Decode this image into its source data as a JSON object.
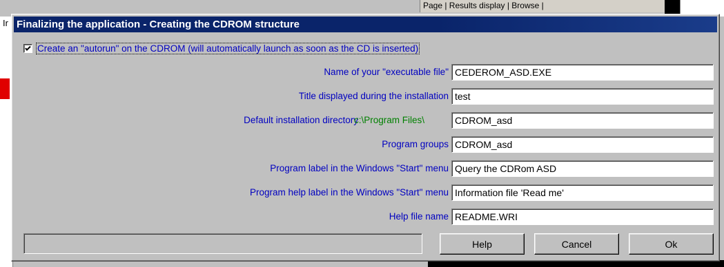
{
  "background": {
    "tabs_text": "Page | Results display | Browse |",
    "left_fragment": "Ir"
  },
  "dialog": {
    "title": "Finalizing the application - Creating the CDROM structure",
    "autorun": {
      "checked": true,
      "label": "Create an \"autorun\" on the CDROM (will automatically launch as soon as the CD is inserted)"
    },
    "fields": [
      {
        "label": "Name of your \"executable file\"",
        "value": "CEDEROM_ASD.EXE"
      },
      {
        "label": "Title displayed during the installation",
        "value": "test"
      },
      {
        "label": "Default installation directory",
        "prefix": "c:\\Program Files\\",
        "value": "CDROM_asd"
      },
      {
        "label": "Program groups",
        "value": "CDROM_asd"
      },
      {
        "label": "Program label in the Windows \"Start\" menu",
        "value": "Query the CDRom ASD"
      },
      {
        "label": "Program help label in the Windows \"Start\" menu",
        "value": "Information file 'Read me'"
      },
      {
        "label": "Help file name",
        "value": "README.WRI"
      }
    ],
    "buttons": {
      "help": "Help",
      "cancel": "Cancel",
      "ok": "Ok"
    }
  },
  "colors": {
    "title_bar": "#0a246a",
    "label_text": "#0000c0",
    "prefix_text": "#008000"
  }
}
